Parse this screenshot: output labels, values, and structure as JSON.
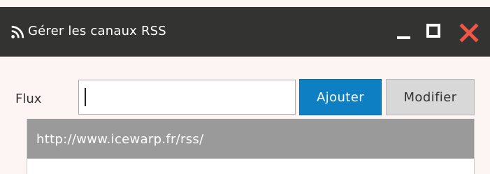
{
  "window": {
    "title": "Gérer les canaux RSS",
    "controls": {
      "minimize": "minimize-icon",
      "maximize": "maximize-icon",
      "close": "close-icon"
    }
  },
  "form": {
    "label": "Flux",
    "input_value": "",
    "input_placeholder": "",
    "add_label": "Ajouter",
    "modify_label": "Modifier"
  },
  "feeds": {
    "items": [
      {
        "url": "http://www.icewarp.fr/rss/",
        "selected": true
      }
    ]
  },
  "colors": {
    "titlebar": "#333431",
    "close": "#f05545",
    "primary": "#0f7fc4",
    "selected_row": "#9a9a9a",
    "background": "#fdf4f4"
  }
}
